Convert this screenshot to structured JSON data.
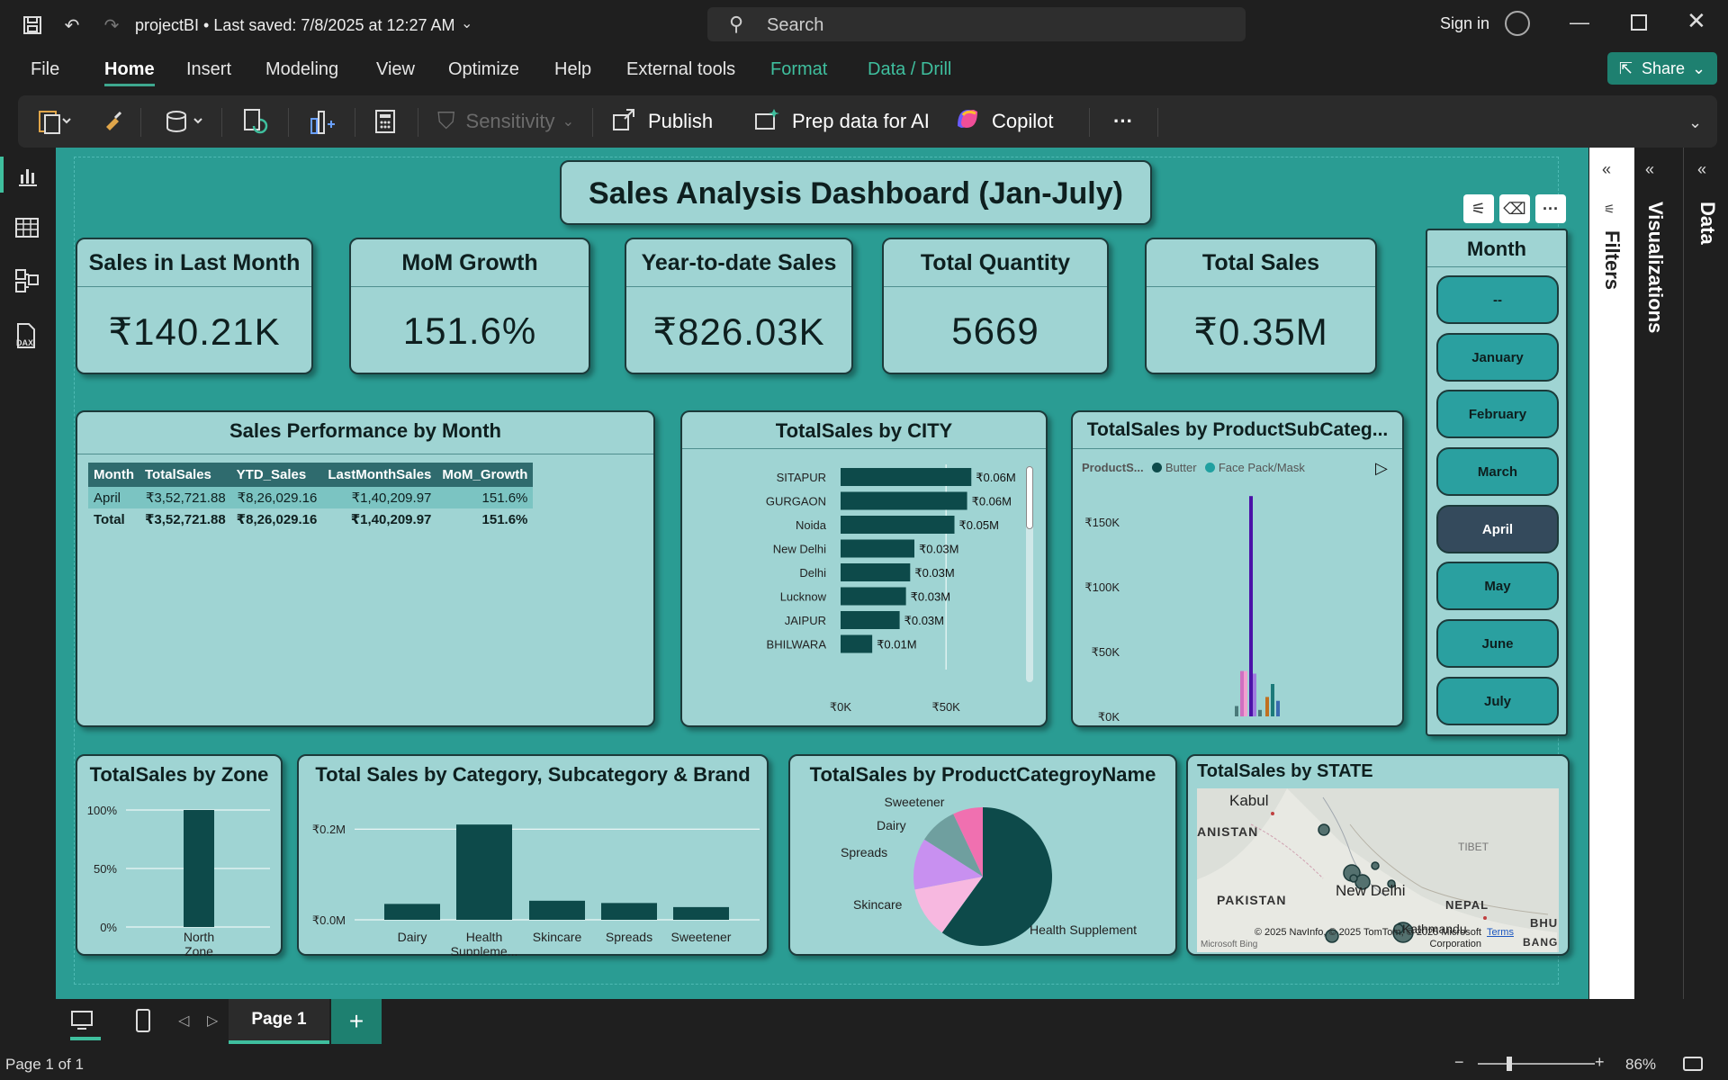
{
  "window": {
    "title": "projectBI • Last saved: 7/8/2025 at 12:27 AM",
    "search_placeholder": "Search",
    "sign_in": "Sign in"
  },
  "menu": {
    "items": [
      "File",
      "Home",
      "Insert",
      "Modeling",
      "View",
      "Optimize",
      "Help",
      "External tools",
      "Format",
      "Data / Drill"
    ],
    "share": "Share"
  },
  "ribbon": {
    "sensitivity": "Sensitivity",
    "publish": "Publish",
    "prep_data": "Prep data for AI",
    "copilot": "Copilot",
    "more": "···"
  },
  "dashboard": {
    "title": "Sales Analysis Dashboard (Jan-July)"
  },
  "kpis": [
    {
      "title": "Sales in Last Month",
      "value": "₹140.21K"
    },
    {
      "title": "MoM Growth",
      "value": "151.6%"
    },
    {
      "title": "Year-to-date Sales",
      "value": "₹826.03K"
    },
    {
      "title": "Total Quantity",
      "value": "5669"
    },
    {
      "title": "Total Sales",
      "value": "₹0.35M"
    }
  ],
  "perf_table": {
    "title": "Sales Performance by Month",
    "headers": [
      "Month",
      "TotalSales",
      "YTD_Sales",
      "LastMonthSales",
      "MoM_Growth"
    ],
    "rows": [
      [
        "April",
        "₹3,52,721.88",
        "₹8,26,029.16",
        "₹1,40,209.97",
        "151.6%"
      ]
    ],
    "total": [
      "Total",
      "₹3,52,721.88",
      "₹8,26,029.16",
      "₹1,40,209.97",
      "151.6%"
    ]
  },
  "month_slicer": {
    "title": "Month",
    "options": [
      "--",
      "January",
      "February",
      "March",
      "April",
      "May",
      "June",
      "July"
    ],
    "selected": "April"
  },
  "chart_data": [
    {
      "type": "bar",
      "orientation": "horizontal",
      "title": "TotalSales by CITY",
      "categories": [
        "SITAPUR",
        "GURGAON",
        "Noida",
        "New Delhi",
        "Delhi",
        "Lucknow",
        "JAIPUR",
        "BHILWARA"
      ],
      "values": [
        62000,
        60000,
        54000,
        35000,
        33000,
        31000,
        28000,
        15000
      ],
      "data_labels": [
        "₹0.06M",
        "₹0.06M",
        "₹0.05M",
        "₹0.03M",
        "₹0.03M",
        "₹0.03M",
        "₹0.03M",
        "₹0.01M"
      ],
      "x_ticks": [
        "₹0K",
        "₹50K"
      ],
      "xlim": [
        0,
        70000
      ],
      "color": "#0d4a4a"
    },
    {
      "type": "bar",
      "title": "TotalSales by ProductSubCateg...",
      "legend_title": "ProductS...",
      "legend": [
        {
          "name": "Butter",
          "color": "#0d4a4a"
        },
        {
          "name": "Face Pack/Mask",
          "color": "#20a0a0"
        }
      ],
      "y_ticks": [
        "₹0K",
        "₹50K",
        "₹100K",
        "₹150K"
      ],
      "ylim": [
        0,
        175000
      ],
      "series": [
        {
          "color": "#4a7a7a",
          "value": 8000
        },
        {
          "color": "#d070c0",
          "value": 35000
        },
        {
          "color": "#f0a0d0",
          "value": 35000
        },
        {
          "color": "#4b12a8",
          "value": 170000
        },
        {
          "color": "#a07ae0",
          "value": 33000
        },
        {
          "color": "#4a7a7a",
          "value": 5000
        },
        {
          "color": "#c07020",
          "value": 15000
        },
        {
          "color": "#1c7a7a",
          "value": 25000
        },
        {
          "color": "#3a6ab0",
          "value": 12000
        }
      ]
    },
    {
      "type": "bar",
      "title": "TotalSales by Zone",
      "categories": [
        "North Zone"
      ],
      "values": [
        100
      ],
      "y_ticks": [
        "0%",
        "50%",
        "100%"
      ],
      "ylim": [
        0,
        100
      ],
      "color": "#0d4a4a"
    },
    {
      "type": "bar",
      "title": "Total Sales by Category, Subcategory & Brand",
      "categories": [
        "Dairy",
        "Health Suppleme...",
        "Skincare",
        "Spreads",
        "Sweetener"
      ],
      "values": [
        0.035,
        0.21,
        0.042,
        0.037,
        0.028
      ],
      "y_ticks": [
        "₹0.0M",
        "₹0.2M"
      ],
      "ylim": [
        0,
        0.25
      ],
      "color": "#0d4a4a"
    },
    {
      "type": "pie",
      "title": "TotalSales by ProductCategroyName",
      "slices": [
        {
          "label": "Health Supplement",
          "value": 0.6,
          "color": "#0d4a4a"
        },
        {
          "label": "Skincare",
          "value": 0.12,
          "color": "#f7b8e0"
        },
        {
          "label": "Spreads",
          "value": 0.12,
          "color": "#c890f0"
        },
        {
          "label": "Dairy",
          "value": 0.09,
          "color": "#6f9f9f"
        },
        {
          "label": "Sweetener",
          "value": 0.07,
          "color": "#f070b0"
        }
      ]
    }
  ],
  "map": {
    "title": "TotalSales by STATE",
    "labels": [
      "Kabul",
      "ANISTAN",
      "PAKISTAN",
      "TIBET",
      "New Delhi",
      "NEPAL",
      "Kathmandu",
      "BHU",
      "BANGLA"
    ],
    "attribution": "© 2025 NavInfo, © 2025 TomTom, © 2025 Microsoft Corporation",
    "terms": "Terms",
    "bing": "Microsoft Bing"
  },
  "panes": {
    "filters": "Filters",
    "visualizations": "Visualizations",
    "data": "Data"
  },
  "pages": {
    "tab": "Page 1",
    "status": "Page 1 of 1",
    "zoom": "86%"
  }
}
